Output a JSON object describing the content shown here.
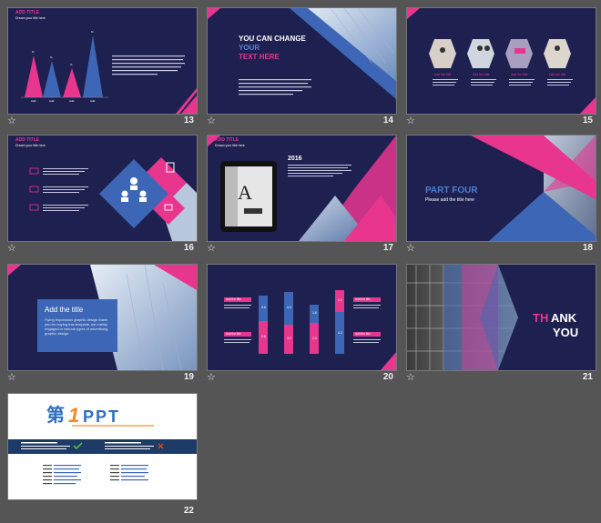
{
  "common": {
    "add_title": "ADD TITLE",
    "subtitle": "Dream your title here"
  },
  "slides": [
    {
      "num": "13",
      "pct": [
        "%",
        "%",
        "%",
        "%"
      ],
      "labels": [
        "Add",
        "Add",
        "Add",
        "Add"
      ]
    },
    {
      "num": "14",
      "line1": "YOU CAN CHANGE",
      "line2": "YOUR",
      "line3": "TEXT HERE"
    },
    {
      "num": "15",
      "item": "Add the title"
    },
    {
      "num": "16"
    },
    {
      "num": "17",
      "year": "2016"
    },
    {
      "num": "18",
      "part": "PART FOUR",
      "sub": "Please add the title here"
    },
    {
      "num": "19",
      "title": "Add the title",
      "body": "Flying impression graphic design thank you for buying this template, we mainly engaged in various types of advertising graphic design."
    },
    {
      "num": "20",
      "bars": [
        {
          "top": "3.6",
          "bot": "2.8"
        },
        {
          "top": "4.4",
          "bot": "3.2"
        },
        {
          "top": "1.6",
          "bot": "2.2"
        },
        {
          "top": "4.1",
          "bot": "4.2"
        }
      ],
      "item": "Add the title"
    },
    {
      "num": "21",
      "thank_a": "TH",
      "thank_b": "ANK",
      "you": "YOU"
    },
    {
      "num": "22",
      "logo_a": "第",
      "logo_b": "1",
      "logo_c": "PPT"
    }
  ],
  "colors": {
    "navy": "#1e2050",
    "pink": "#e8368f",
    "blue": "#3d67b6",
    "bg": "#555555"
  }
}
